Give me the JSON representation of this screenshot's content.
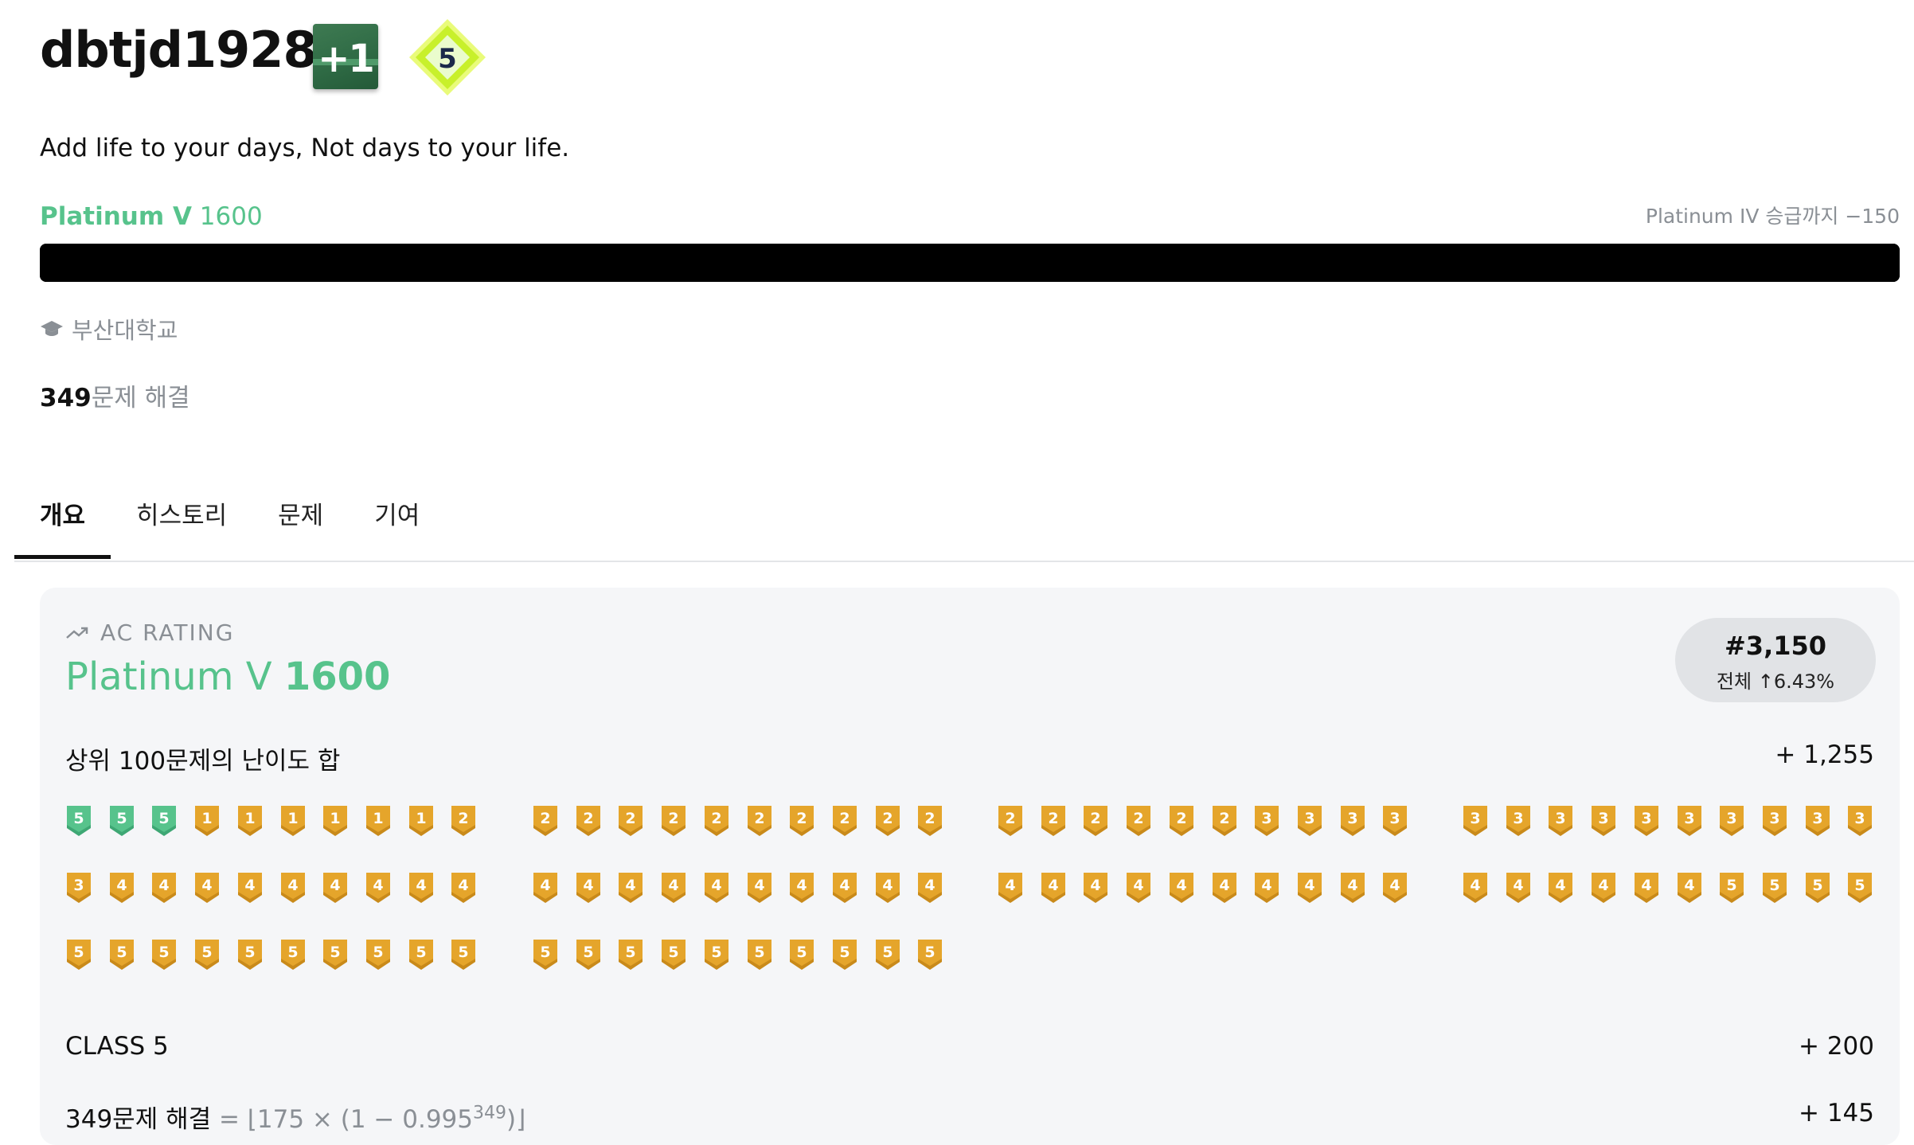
{
  "profile": {
    "username": "dbtjd1928",
    "plus_badge": "+1",
    "class_badge": "5",
    "bio": "Add life to your days, Not days to your life.",
    "tier_name": "Platinum V",
    "rating": "1600",
    "next_tier": "Platinum IV 승급까지 −150",
    "progress": 1.0,
    "school": "부산대학교",
    "solved_count": "349",
    "solved_suffix": "문제 해결"
  },
  "tabs": [
    {
      "label": "개요",
      "active": true
    },
    {
      "label": "히스토리",
      "active": false
    },
    {
      "label": "문제",
      "active": false
    },
    {
      "label": "기여",
      "active": false
    }
  ],
  "ac_rating": {
    "label": "AC RATING",
    "tier_name": "Platinum V",
    "rating": "1600",
    "rank": "#3,150",
    "rank_sub": "전체 ↑6.43%",
    "top100_label": "상위 100문제의 난이도 합",
    "top100_value": "+ 1,255",
    "class_label": "CLASS 5",
    "class_value": "+ 200",
    "solved_label": "349문제 해결",
    "solved_formula_prefix": "= ⌊175 × (1 − 0.995",
    "solved_formula_exp": "349",
    "solved_formula_suffix": ")⌋",
    "solved_value": "+ 145"
  },
  "problem_tiers": [
    "p5",
    "p5",
    "p5",
    "g1",
    "g1",
    "g1",
    "g1",
    "g1",
    "g1",
    "g2",
    "g2",
    "g2",
    "g2",
    "g2",
    "g2",
    "g2",
    "g2",
    "g2",
    "g2",
    "g2",
    "g2",
    "g2",
    "g2",
    "g2",
    "g2",
    "g2",
    "g3",
    "g3",
    "g3",
    "g3",
    "g3",
    "g3",
    "g3",
    "g3",
    "g3",
    "g3",
    "g3",
    "g3",
    "g3",
    "g3",
    "g3",
    "g4",
    "g4",
    "g4",
    "g4",
    "g4",
    "g4",
    "g4",
    "g4",
    "g4",
    "g4",
    "g4",
    "g4",
    "g4",
    "g4",
    "g4",
    "g4",
    "g4",
    "g4",
    "g4",
    "g4",
    "g4",
    "g4",
    "g4",
    "g4",
    "g4",
    "g4",
    "g4",
    "g4",
    "g4",
    "g4",
    "g4",
    "g4",
    "g4",
    "g4",
    "g4",
    "g5",
    "g5",
    "g5",
    "g5",
    "g5",
    "g5",
    "g5",
    "g5",
    "g5",
    "g5",
    "g5",
    "g5",
    "g5",
    "g5",
    "g5",
    "g5",
    "g5",
    "g5",
    "g5",
    "g5",
    "g5",
    "g5",
    "g5",
    "g5"
  ],
  "colors": {
    "platinum": "#57c38c",
    "gold": "#e5a52b",
    "progress": "#000000",
    "card_bg": "#f5f6f8"
  },
  "icons": {
    "school": "graduation-cap-icon",
    "rating": "trending-up-icon"
  }
}
